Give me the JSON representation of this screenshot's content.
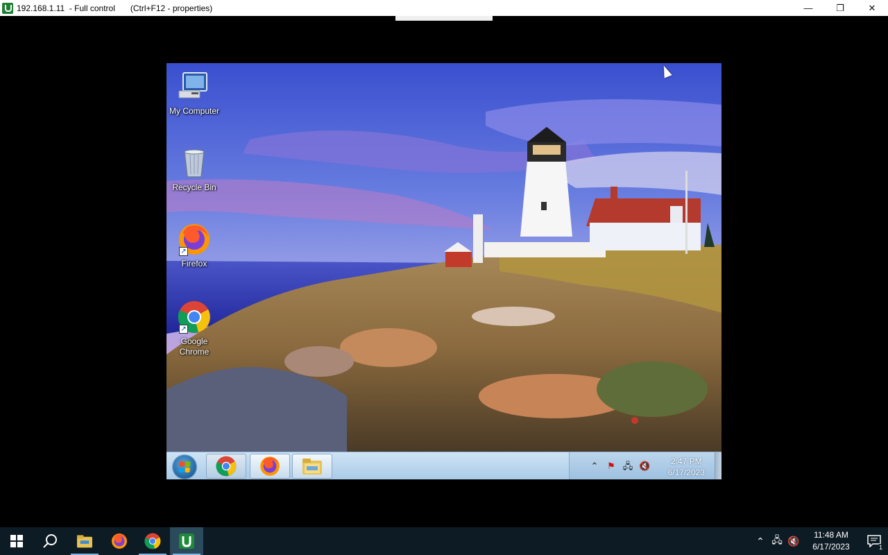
{
  "window": {
    "title": "192.168.1.11  - Full control",
    "hint": "(Ctrl+F12 - properties)",
    "minimize": "—",
    "restore": "❐",
    "close": "✕"
  },
  "remote_desktop": {
    "icons": [
      {
        "label": "My Computer",
        "icon": "computer-icon"
      },
      {
        "label": "Recycle Bin",
        "icon": "recycle-bin-icon"
      },
      {
        "label": "Firefox",
        "icon": "firefox-icon"
      },
      {
        "label": "Google Chrome",
        "icon": "chrome-icon"
      }
    ],
    "taskbar": {
      "pinned": [
        "chrome-icon",
        "firefox-icon",
        "file-explorer-icon"
      ],
      "tray_icons": [
        "show-hidden-icons",
        "action-center-error-icon",
        "network-icon",
        "volume-muted-icon"
      ],
      "time": "2:47 PM",
      "date": "6/17/2023"
    }
  },
  "local_taskbar": {
    "apps": [
      "start-icon",
      "search-icon",
      "file-explorer-icon",
      "firefox-icon",
      "chrome-icon",
      "remote-viewer-icon"
    ],
    "time": "11:48 AM",
    "date": "6/17/2023",
    "notifications_count": "1"
  },
  "colors": {
    "local_taskbar": "#0d1b24",
    "remote_taskbar": "#b4d3ee",
    "accent": "#7fb8e6"
  }
}
